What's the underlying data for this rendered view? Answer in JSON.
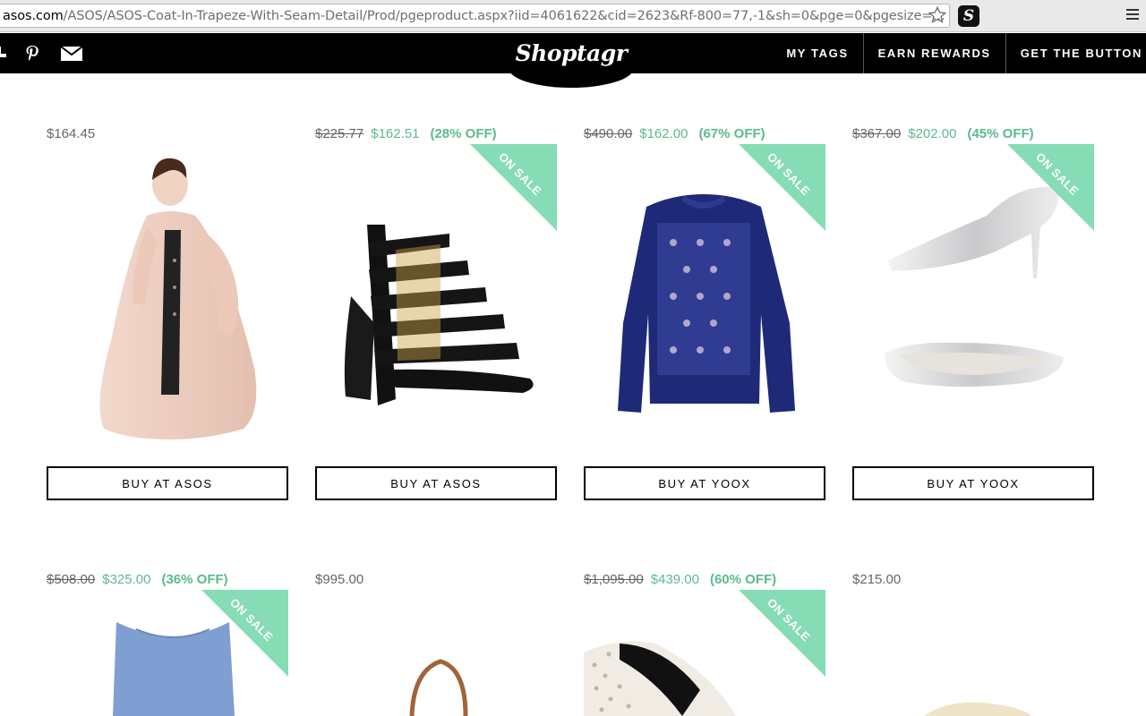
{
  "browser": {
    "url_host": "asos.com",
    "url_path": "/ASOS/ASOS-Coat-In-Trapeze-With-Seam-Detail/Prod/pgeproduct.aspx?iid=4061622&cid=2623&Rf-800=77,-1&sh=0&pge=0&pgesize=…",
    "extension_label": "S"
  },
  "header": {
    "logo": "Shoptagr",
    "nav": [
      "MY TAGS",
      "EARN REWARDS",
      "GET THE BUTTON"
    ]
  },
  "products": [
    {
      "price": "$164.45",
      "on_sale": false,
      "buy_label": "BUY AT ASOS",
      "image": "pink-trapeze-coat"
    },
    {
      "price_old": "$225.77",
      "price_sale": "$162.51",
      "discount": "(28% OFF)",
      "on_sale": true,
      "ribbon": "ON SALE",
      "buy_label": "BUY AT ASOS",
      "image": "black-caged-sandal"
    },
    {
      "price_old": "$490.00",
      "price_sale": "$162.00",
      "discount": "(67% OFF)",
      "on_sale": true,
      "ribbon": "ON SALE",
      "buy_label": "BUY AT YOOX",
      "image": "navy-embroidered-sweater"
    },
    {
      "price_old": "$367.00",
      "price_sale": "$202.00",
      "discount": "(45% OFF)",
      "on_sale": true,
      "ribbon": "ON SALE",
      "buy_label": "BUY AT YOOX",
      "image": "silver-pumps"
    },
    {
      "price_old": "$508.00",
      "price_sale": "$325.00",
      "discount": "(36% OFF)",
      "on_sale": true,
      "ribbon": "ON SALE",
      "image": "blue-sleeveless-dress"
    },
    {
      "price": "$995.00",
      "on_sale": false,
      "image": "tan-handbag"
    },
    {
      "price_old": "$1,095.00",
      "price_sale": "$439.00",
      "discount": "(60% OFF)",
      "on_sale": true,
      "ribbon": "ON SALE",
      "image": "studded-white-shoe"
    },
    {
      "price": "$215.00",
      "on_sale": false,
      "image": "cream-shoe"
    }
  ],
  "colors": {
    "sale_green": "#5cba8f",
    "ribbon_green": "#86dcb4",
    "header_black": "#000000"
  }
}
